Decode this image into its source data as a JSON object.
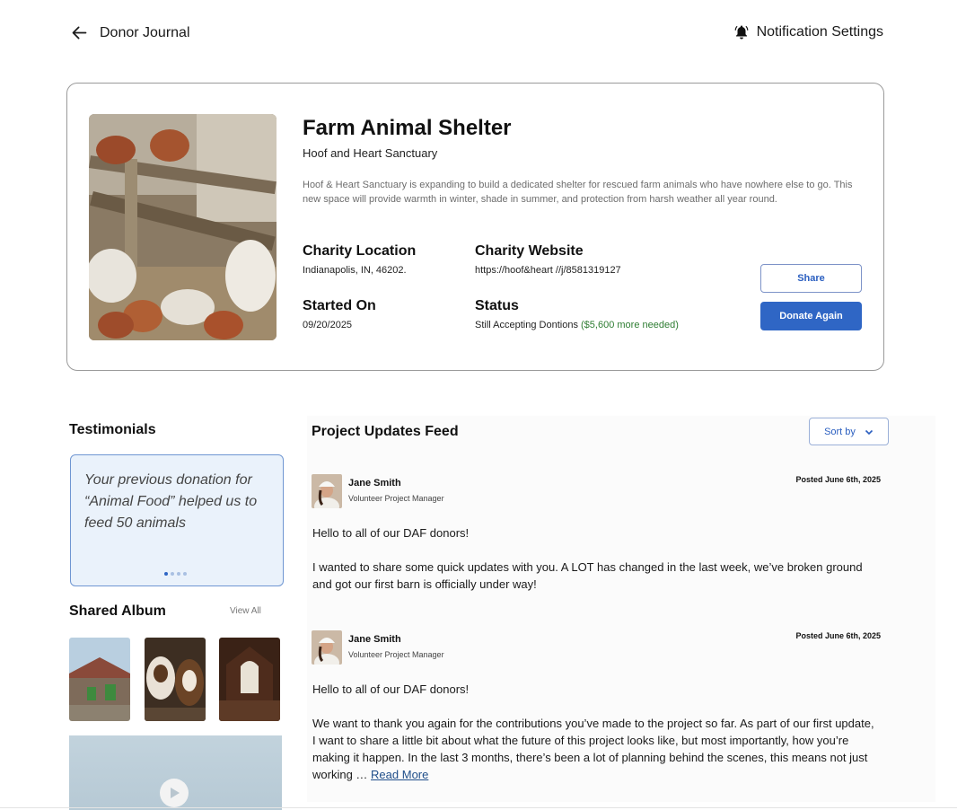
{
  "header": {
    "back_label": "Donor Journal",
    "notification_label": "Notification Settings"
  },
  "charity": {
    "title": "Farm Animal Shelter",
    "organization": "Hoof and Heart Sanctuary",
    "description": "Hoof & Heart Sanctuary is expanding to build a dedicated shelter for rescued farm animals who have nowhere else to go. This new space will provide warmth in winter, shade in summer, and protection from harsh weather all year round.",
    "location_label": "Charity Location",
    "location_value": "Indianapolis, IN, 46202.",
    "website_label": "Charity Website",
    "website_value": "https://hoof&heart //j/8581319127",
    "started_label": "Started On",
    "started_value": "09/20/2025",
    "status_label": "Status",
    "status_value": "Still Accepting Dontions",
    "status_needed": "($5,600 more needed)",
    "share_label": "Share",
    "donate_label": "Donate Again"
  },
  "testimonials": {
    "heading": "Testimonials",
    "quote": "Your previous donation for “Animal Food” helped us to feed 50 animals",
    "page_count": 4,
    "active_page": 1
  },
  "album": {
    "heading": "Shared Album",
    "view_all_label": "View All"
  },
  "feed": {
    "heading": "Project Updates Feed",
    "sort_label": "Sort by",
    "posts": [
      {
        "author": "Jane Smith",
        "role": "Volunteer Project Manager",
        "date": "Posted June 6th, 2025",
        "greeting": "Hello to all of our DAF donors!",
        "text": "I wanted to share some quick updates with you. A LOT has changed in the last week, we’ve broken ground and got our first barn is officially under way!"
      },
      {
        "author": "Jane Smith",
        "role": "Volunteer Project Manager",
        "date": "Posted June 6th, 2025",
        "greeting": "Hello to all of our DAF donors!",
        "text": "We want to thank you again for the contributions you’ve made to the project so far. As part of our first update, I want to share a little bit about what the future of this project looks like, but most importantly, how you’re making it happen. In the last 3 months, there’s been a lot of planning behind the scenes, this means not just working …",
        "read_more": "Read More"
      }
    ]
  },
  "colors": {
    "accent": "#2f66c5",
    "success": "#2e7d32",
    "testimonial_bg": "#eaf2fb"
  }
}
